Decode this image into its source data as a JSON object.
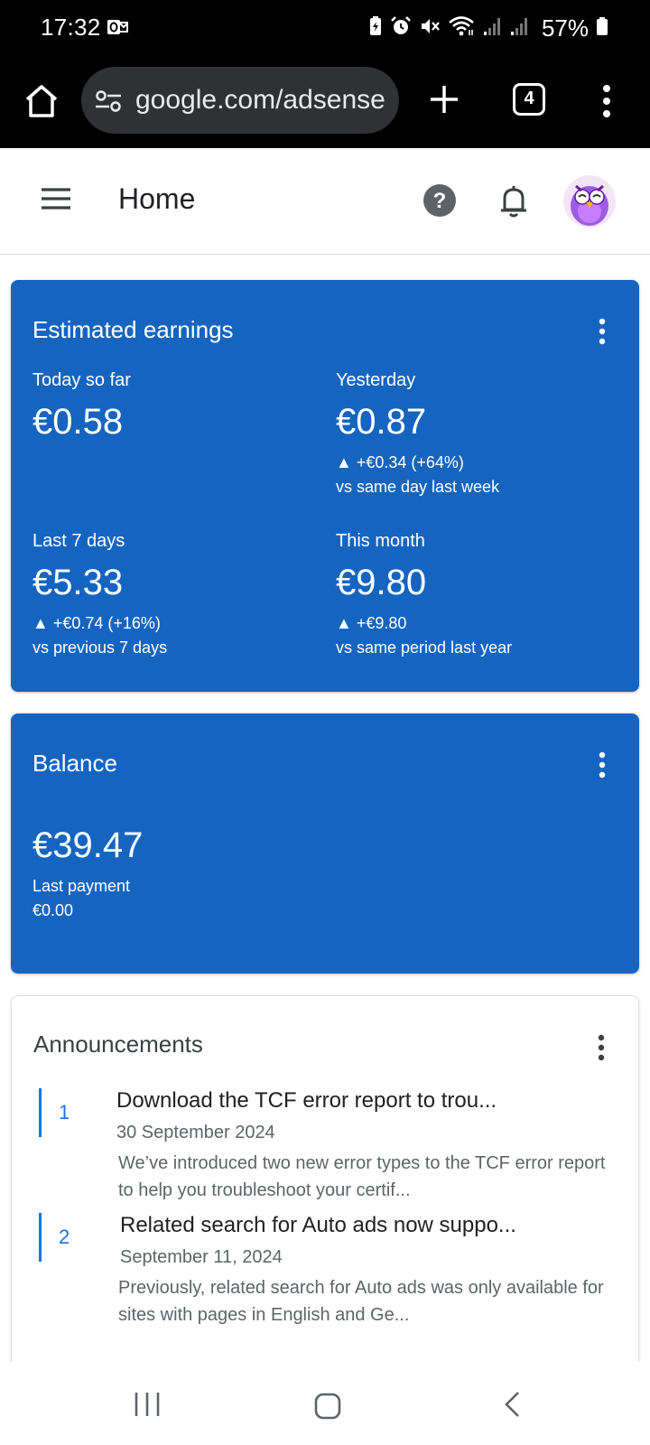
{
  "status_bar": {
    "time": "17:32",
    "battery_percent": "57%"
  },
  "browser": {
    "url": "google.com/adsense",
    "tab_count": "4"
  },
  "header": {
    "title": "Home"
  },
  "earnings_card": {
    "title": "Estimated earnings",
    "metrics": [
      {
        "label": "Today so far",
        "value": "€0.58",
        "change": "",
        "compare": ""
      },
      {
        "label": "Yesterday",
        "value": "€0.87",
        "change": "▲ +€0.34 (+64%)",
        "compare": "vs same day last week"
      },
      {
        "label": "Last 7 days",
        "value": "€5.33",
        "change": "▲ +€0.74 (+16%)",
        "compare": "vs previous 7 days"
      },
      {
        "label": "This month",
        "value": "€9.80",
        "change": "▲ +€9.80",
        "compare": "vs same period last year"
      }
    ]
  },
  "balance_card": {
    "title": "Balance",
    "value": "€39.47",
    "last_payment_label": "Last payment",
    "last_payment_value": "€0.00"
  },
  "announcements_card": {
    "title": "Announcements",
    "items": [
      {
        "number": "1",
        "title": "Download the TCF error report to trou...",
        "date": "30 September 2024",
        "description": "We’ve introduced two new error types to the TCF error report to help you troubleshoot your certif..."
      },
      {
        "number": "2",
        "title": "Related search for Auto ads now suppo...",
        "date": "September 11, 2024",
        "description": "Previously, related search for Auto ads was only available for sites with pages in English and Ge..."
      }
    ]
  },
  "colors": {
    "card_blue": "#1565c0",
    "accent_blue": "#1a73e8",
    "browser_bar": "#000000",
    "url_pill": "#2f3133"
  },
  "icons": {
    "status_left": "outlook-notification-icon",
    "status_right": [
      "battery-saver-icon",
      "alarm-icon",
      "mute-icon",
      "wifi-icon",
      "signal-icon",
      "signal-icon",
      "battery-icon"
    ],
    "browser": [
      "home-icon",
      "site-settings-icon",
      "new-tab-icon",
      "tab-switcher-icon",
      "more-vert-icon"
    ],
    "header": [
      "menu-icon",
      "help-icon",
      "bell-icon",
      "avatar"
    ],
    "nav": [
      "recent-apps-icon",
      "home-circle-icon",
      "back-icon"
    ]
  }
}
